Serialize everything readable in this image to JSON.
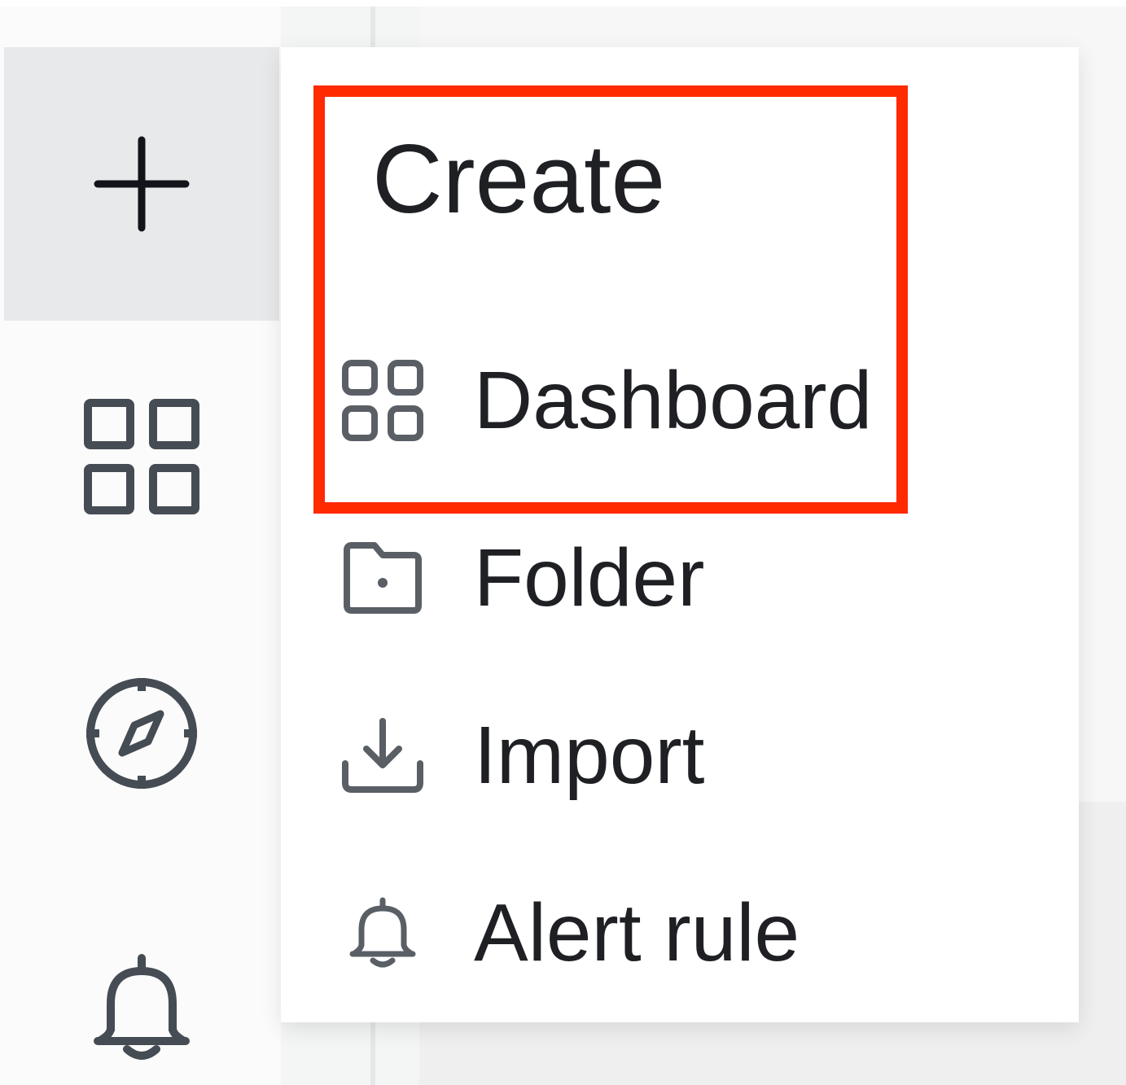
{
  "sidebar": {
    "items": [
      {
        "icon": "plus-icon",
        "active": true
      },
      {
        "icon": "grid-icon",
        "active": false
      },
      {
        "icon": "compass-icon",
        "active": false
      },
      {
        "icon": "bell-icon",
        "active": false
      }
    ]
  },
  "menu": {
    "title": "Create",
    "items": [
      {
        "label": "Dashboard",
        "icon": "apps-icon"
      },
      {
        "label": "Folder",
        "icon": "folder-plus-icon"
      },
      {
        "label": "Import",
        "icon": "import-icon"
      },
      {
        "label": "Alert rule",
        "icon": "bell-icon"
      }
    ]
  },
  "annotation": {
    "highlight_color": "#ff2a00",
    "highlights": [
      "menu.title",
      "menu.items.0"
    ]
  },
  "colors": {
    "text": "#1e2024",
    "icon": "#464c54",
    "sidebar_active_bg": "#e8e9ea"
  }
}
